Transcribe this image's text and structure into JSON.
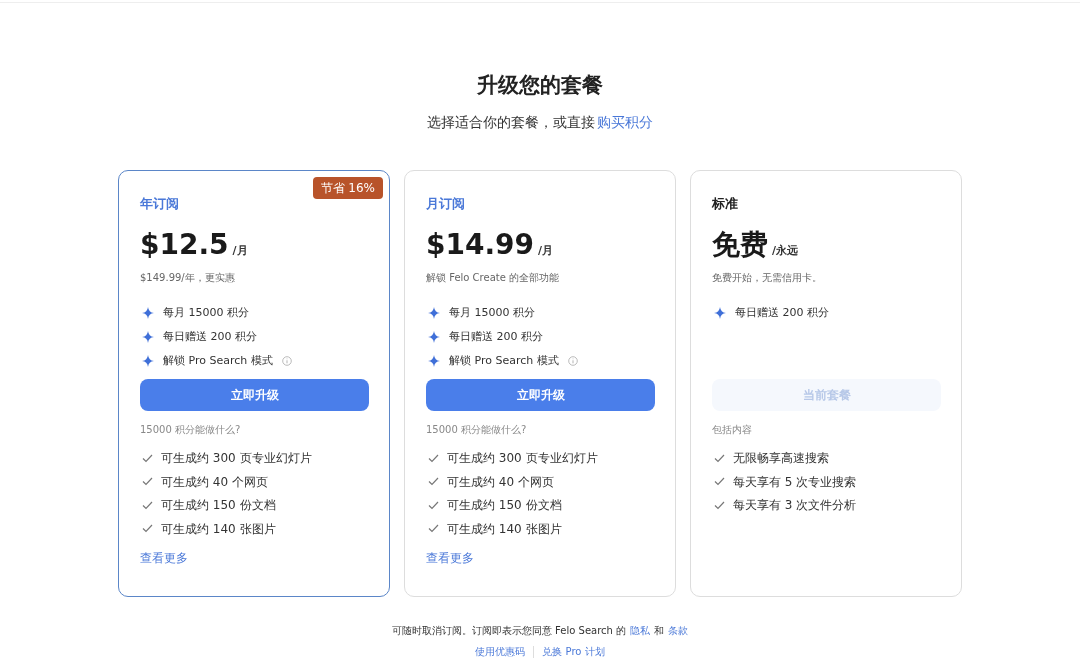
{
  "header": {
    "title": "升级您的套餐",
    "subtitle": "选择适合你的套餐，或直接",
    "subtitle_link": "购买积分"
  },
  "plans": [
    {
      "kind": "paid",
      "selected": true,
      "name": "年订阅",
      "badge": "节省 16%",
      "price": "$12.5",
      "unit": "/月",
      "note": "$149.99/年，更实惠",
      "features": [
        {
          "text": "每月 15000 积分",
          "info": false
        },
        {
          "text": "每日赠送 200 积分",
          "info": false
        },
        {
          "text": "解锁 Pro Search 模式",
          "info": true
        }
      ],
      "button": {
        "label": "立即升级",
        "disabled": false
      },
      "list_title": "15000 积分能做什么?",
      "items": [
        "可生成约 300 页专业幻灯片",
        "可生成约 40 个网页",
        "可生成约 150 份文档",
        "可生成约 140 张图片"
      ],
      "more": "查看更多"
    },
    {
      "kind": "paid",
      "selected": false,
      "name": "月订阅",
      "price": "$14.99",
      "unit": "/月",
      "note": "解锁 Felo Create 的全部功能",
      "features": [
        {
          "text": "每月 15000 积分",
          "info": false
        },
        {
          "text": "每日赠送 200 积分",
          "info": false
        },
        {
          "text": "解锁 Pro Search 模式",
          "info": true
        }
      ],
      "button": {
        "label": "立即升级",
        "disabled": false
      },
      "list_title": "15000 积分能做什么?",
      "items": [
        "可生成约 300 页专业幻灯片",
        "可生成约 40 个网页",
        "可生成约 150 份文档",
        "可生成约 140 张图片"
      ],
      "more": "查看更多"
    },
    {
      "kind": "free",
      "selected": false,
      "name": "标准",
      "price": "免费",
      "unit": "/永远",
      "note": "免费开始，无需信用卡。",
      "features": [
        {
          "text": "每日赠送 200 积分",
          "info": false
        }
      ],
      "button": {
        "label": "当前套餐",
        "disabled": true
      },
      "list_title": "包括内容",
      "items": [
        "无限畅享高速搜索",
        "每天享有 5 次专业搜索",
        "每天享有 3 次文件分析"
      ]
    }
  ],
  "footer": {
    "text": "可随时取消订阅。订阅即表示您同意 Felo Search 的",
    "privacy": "隐私",
    "and": "和",
    "terms": "条款",
    "links": [
      "使用优惠码",
      "兑换 Pro 计划"
    ]
  }
}
